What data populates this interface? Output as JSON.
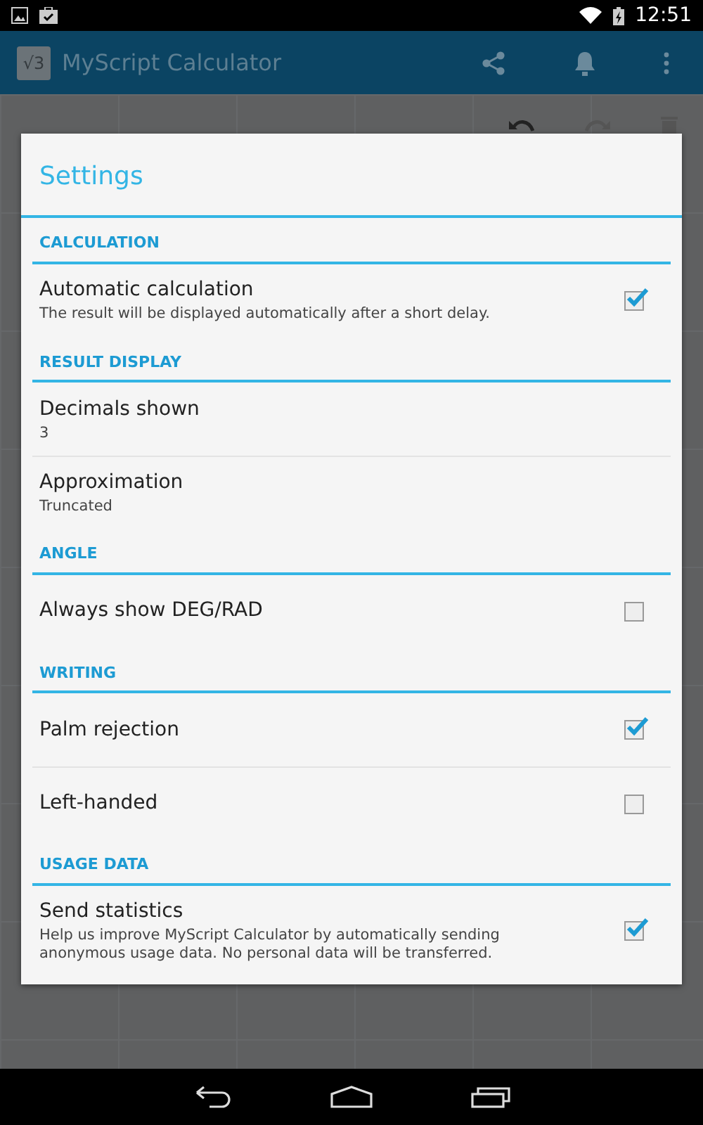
{
  "status_bar": {
    "time": "12:51"
  },
  "app_bar": {
    "logo_text": "√3",
    "title": "MyScript Calculator"
  },
  "dialog": {
    "title": "Settings",
    "sections": [
      {
        "header": "CALCULATION",
        "items": [
          {
            "kind": "checkbox",
            "title": "Automatic calculation",
            "summary": "The result will be displayed automatically after a short delay.",
            "checked": true
          }
        ]
      },
      {
        "header": "RESULT DISPLAY",
        "items": [
          {
            "kind": "value",
            "title": "Decimals shown",
            "summary": "3"
          },
          {
            "kind": "value",
            "title": "Approximation",
            "summary": "Truncated"
          }
        ]
      },
      {
        "header": "ANGLE",
        "items": [
          {
            "kind": "checkbox",
            "title": "Always show DEG/RAD",
            "checked": false
          }
        ]
      },
      {
        "header": "WRITING",
        "items": [
          {
            "kind": "checkbox",
            "title": "Palm rejection",
            "checked": true
          },
          {
            "kind": "checkbox",
            "title": "Left-handed",
            "checked": false
          }
        ]
      },
      {
        "header": "USAGE DATA",
        "items": [
          {
            "kind": "checkbox",
            "title": "Send statistics",
            "summary": "Help us improve MyScript Calculator by automatically sending anonymous usage data. No personal data will be transferred.",
            "checked": true
          }
        ]
      }
    ]
  }
}
